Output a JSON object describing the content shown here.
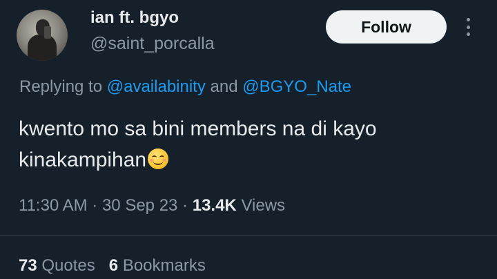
{
  "user": {
    "display_name": "ian ft. bgyo",
    "handle": "@saint_porcalla"
  },
  "follow_button_label": "Follow",
  "more_icon": "more-vertical-icon",
  "reply": {
    "prefix": "Replying to ",
    "mentions": [
      "@availabinity",
      "@BGYO_Nate"
    ],
    "conjunction": " and "
  },
  "tweet_text": "kwento mo sa bini members na di kayo kinakampihan",
  "emoji": "smiling-face-emoji",
  "meta": {
    "time": "11:30 AM",
    "separator": " · ",
    "date": "30 Sep 23",
    "views_count": "13.4K",
    "views_label": "Views"
  },
  "stats": {
    "quotes_count": "73",
    "quotes_label": "Quotes",
    "bookmarks_count": "6",
    "bookmarks_label": "Bookmarks"
  },
  "colors": {
    "background": "#15202b",
    "text_primary": "#e7e9ea",
    "text_secondary": "#8b98a5",
    "link": "#1d9bf0",
    "follow_button_bg": "#eff3f4"
  }
}
